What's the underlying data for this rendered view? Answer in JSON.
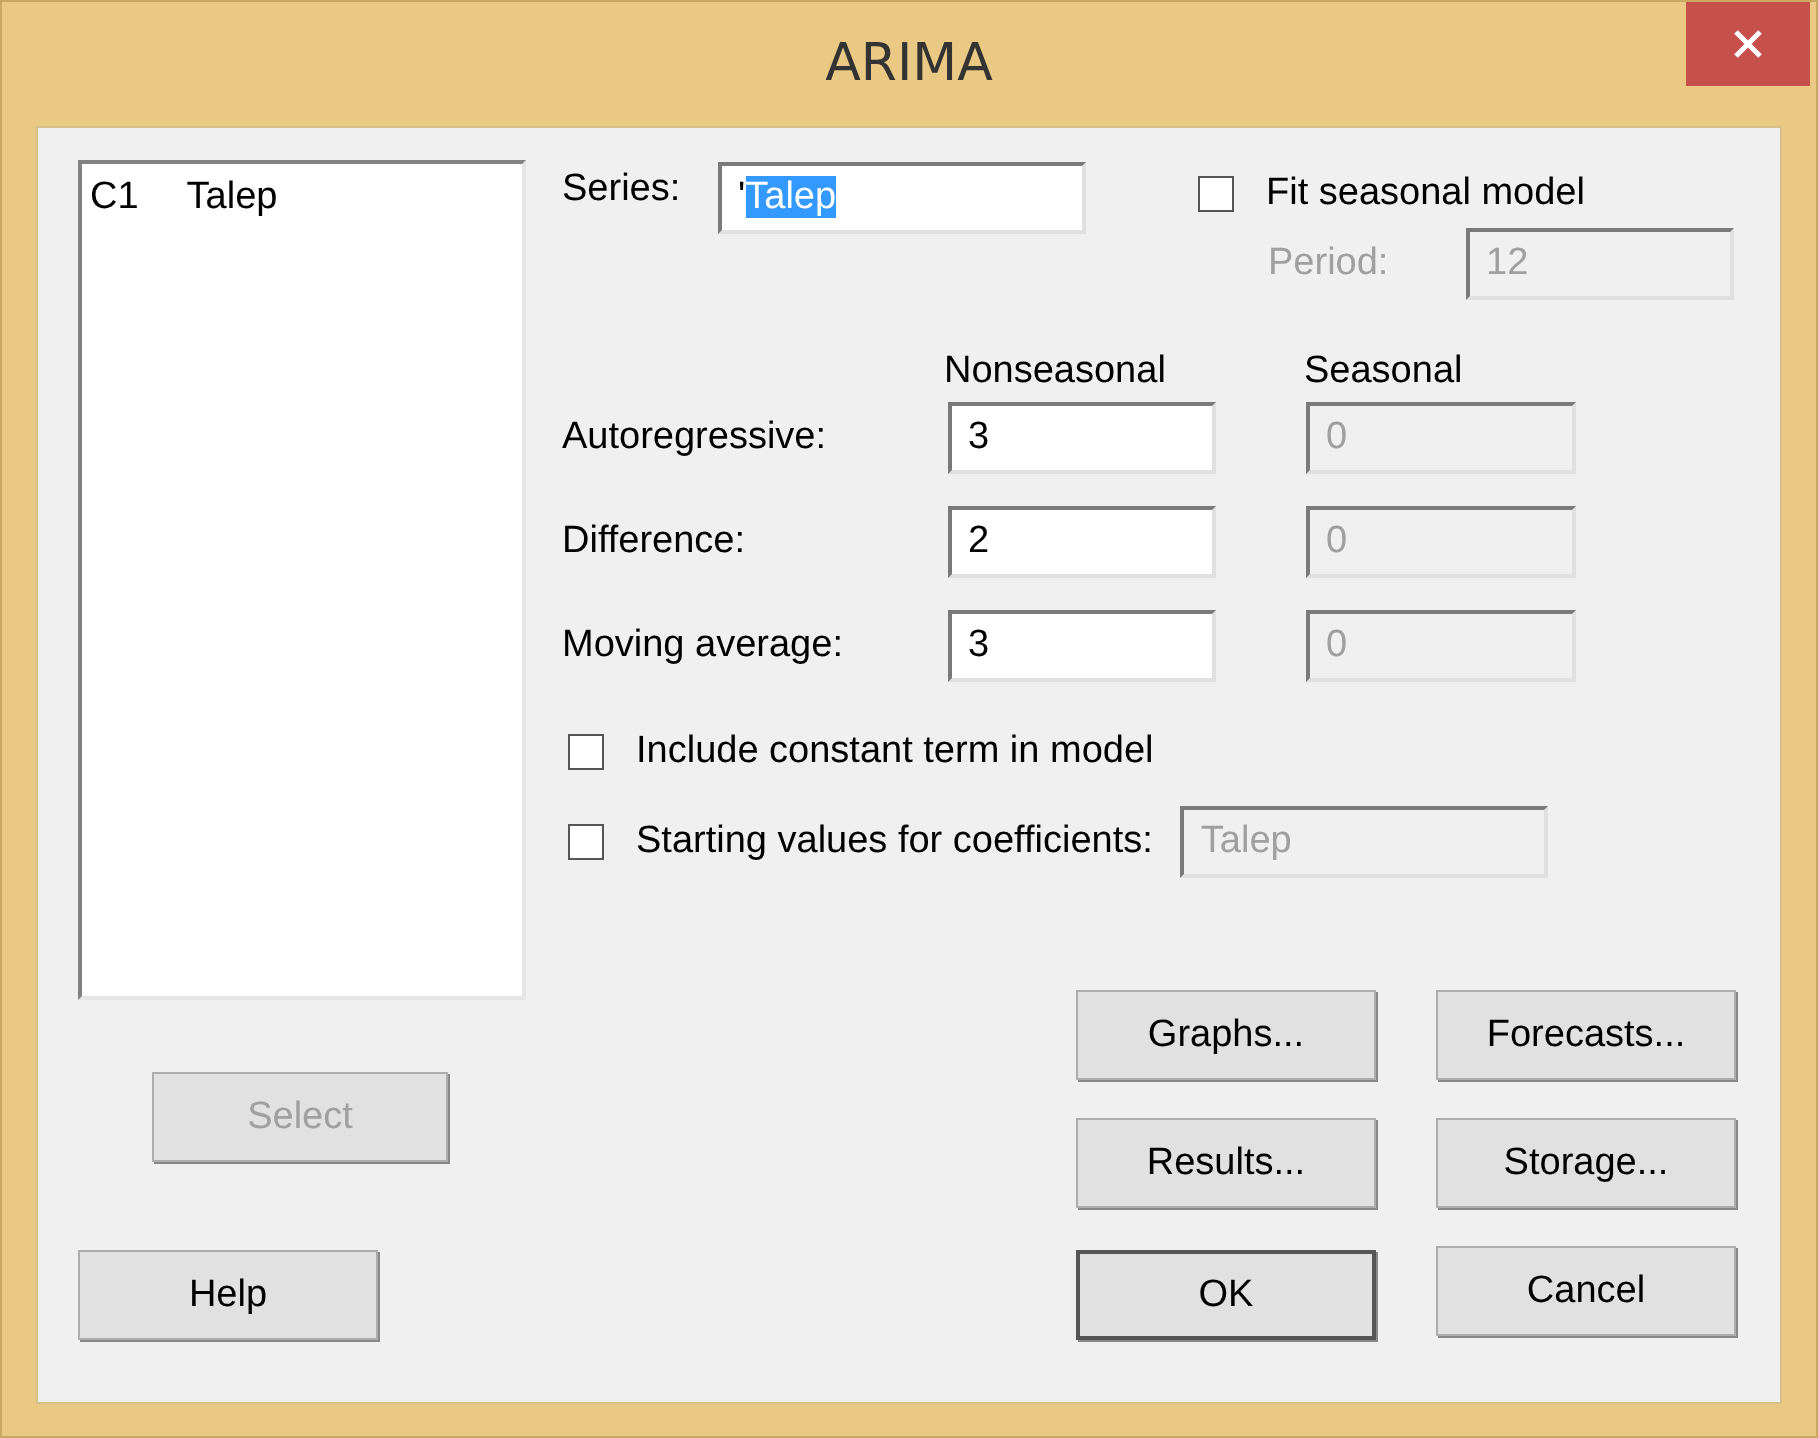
{
  "window": {
    "title": "ARIMA"
  },
  "variables": [
    {
      "column": "C1",
      "name": "Talep"
    }
  ],
  "select_button": {
    "label": "Select",
    "disabled": true
  },
  "series": {
    "label": "Series:",
    "prefix": "'",
    "selected_text": "Talep"
  },
  "fit_seasonal": {
    "label": "Fit seasonal model",
    "checked": false
  },
  "period": {
    "label": "Period:",
    "value": "12",
    "disabled": true
  },
  "order": {
    "columns": [
      "Nonseasonal",
      "Seasonal"
    ],
    "seasonal_disabled": true,
    "rows": [
      {
        "label": "Autoregressive:",
        "nonseasonal": "3",
        "seasonal": "0"
      },
      {
        "label": "Difference:",
        "nonseasonal": "2",
        "seasonal": "0"
      },
      {
        "label": "Moving average:",
        "nonseasonal": "3",
        "seasonal": "0"
      }
    ]
  },
  "options": [
    {
      "label": "Include constant term in model",
      "checked": false
    },
    {
      "label": "Starting values for coefficients:",
      "checked": false,
      "field": {
        "value": "Talep",
        "disabled": true
      }
    }
  ],
  "buttons": [
    {
      "label": "Graphs...",
      "default": false
    },
    {
      "label": "Forecasts...",
      "default": false
    },
    {
      "label": "Results...",
      "default": false
    },
    {
      "label": "Storage...",
      "default": false
    },
    {
      "label": "OK",
      "default": true
    },
    {
      "label": "Cancel",
      "default": false
    }
  ],
  "help_button": {
    "label": "Help"
  }
}
